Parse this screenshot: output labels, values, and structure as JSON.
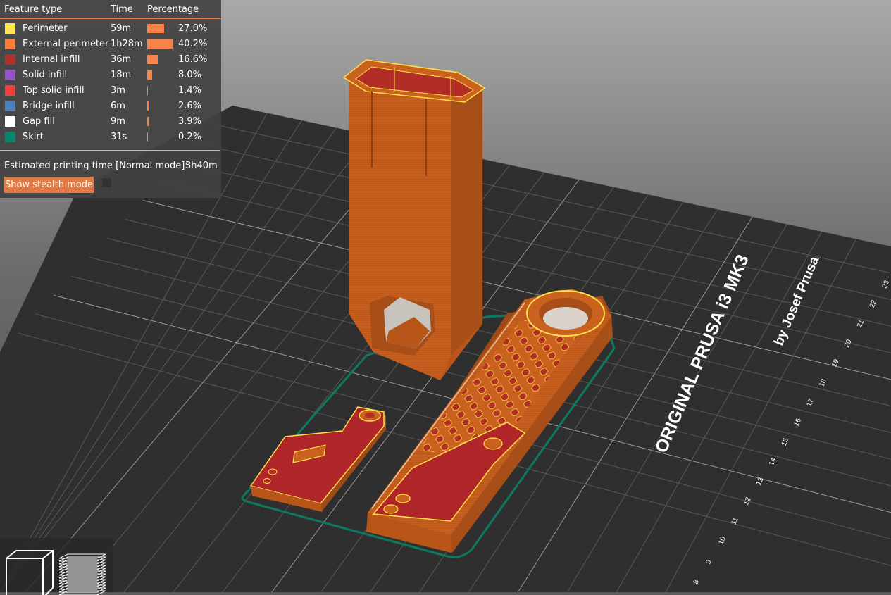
{
  "legend": {
    "headers": {
      "feature": "Feature type",
      "time": "Time",
      "percentage": "Percentage"
    },
    "rows": [
      {
        "name": "Perimeter",
        "time": "59m",
        "percent": "27.0%",
        "fraction": 0.27,
        "color": "#ffe74a"
      },
      {
        "name": "External perimeter",
        "time": "1h28m",
        "percent": "40.2%",
        "fraction": 0.402,
        "color": "#ff7d38"
      },
      {
        "name": "Internal infill",
        "time": "36m",
        "percent": "16.6%",
        "fraction": 0.166,
        "color": "#b0302a"
      },
      {
        "name": "Solid infill",
        "time": "18m",
        "percent": "8.0%",
        "fraction": 0.08,
        "color": "#9654cc"
      },
      {
        "name": "Top solid infill",
        "time": "3m",
        "percent": "1.4%",
        "fraction": 0.014,
        "color": "#f0403c"
      },
      {
        "name": "Bridge infill",
        "time": "6m",
        "percent": "2.6%",
        "fraction": 0.026,
        "color": "#4d80ba"
      },
      {
        "name": "Gap fill",
        "time": "9m",
        "percent": "3.9%",
        "fraction": 0.039,
        "color": "#ffffff"
      },
      {
        "name": "Skirt",
        "time": "31s",
        "percent": "0.2%",
        "fraction": 0.002,
        "color": "#00876e"
      }
    ],
    "estimate_label": "Estimated printing time [Normal mode]:",
    "estimate_value": "3h40m",
    "stealth_button": "Show stealth mode"
  },
  "bed": {
    "brand_line1": "ORIGINAL PRUSA i3 MK3",
    "brand_line2": "by Josef Prusa",
    "ruler_labels": [
      "8",
      "9",
      "10",
      "11",
      "12",
      "13",
      "14",
      "15",
      "16",
      "17",
      "18",
      "19",
      "20",
      "21",
      "22",
      "23"
    ]
  },
  "toolbar": {
    "icons": [
      "cube-view-icon",
      "layers-view-icon"
    ]
  },
  "colors": {
    "filament": "#c9611f",
    "bed": "#2e2e2e",
    "accent": "#e17a45"
  }
}
